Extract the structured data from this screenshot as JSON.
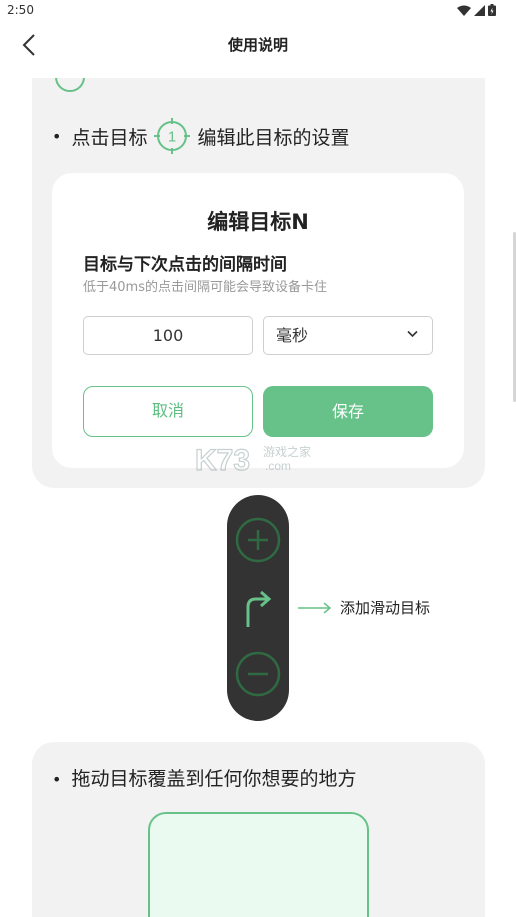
{
  "status_bar": {
    "time": "2:50"
  },
  "app_bar": {
    "title": "使用说明"
  },
  "instructions": {
    "tap_target_text_before": "点击目标",
    "tap_target_number": "1",
    "tap_target_text_after": "编辑此目标的设置",
    "drag_text": "拖动目标覆盖到任何你想要的地方"
  },
  "dialog": {
    "title": "编辑目标N",
    "interval_label": "目标与下次点击的间隔时间",
    "interval_hint": "低于40ms的点击间隔可能会导致设备卡住",
    "interval_value": "100",
    "unit_selected": "毫秒",
    "cancel_label": "取消",
    "save_label": "保存"
  },
  "toolbar": {
    "add_icon": "plus-circle-icon",
    "swipe_icon": "turn-right-arrow-icon",
    "remove_icon": "minus-circle-icon",
    "swipe_label": "添加滑动目标"
  },
  "watermark": {
    "text_main": "K73",
    "text_cn": "游戏之家",
    "text_com": ".com"
  },
  "colors": {
    "accent": "#66c288",
    "toolbar_bg": "#333333",
    "card_bg": "#f2f2f2",
    "drop_zone_bg": "#eafaf0"
  }
}
